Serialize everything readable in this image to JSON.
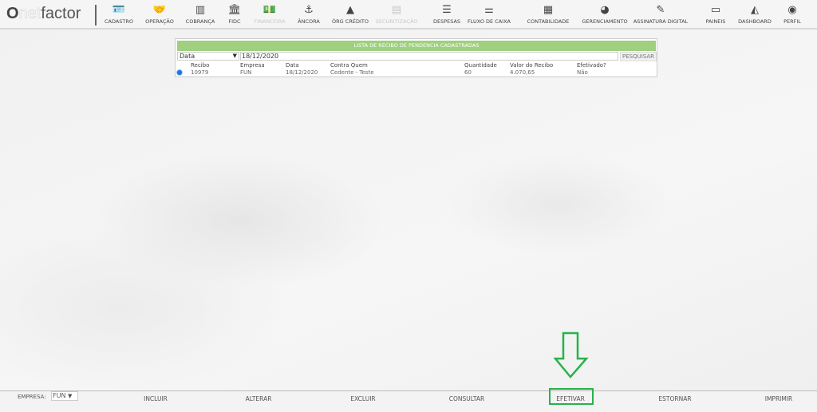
{
  "header": {
    "logo": "netfactor",
    "logo_o": "O",
    "logo_net": "net",
    "logo_factor": "factor",
    "nav": [
      {
        "label": "CADASTRO",
        "icon": "id-card-icon",
        "glyph": "🪪",
        "disabled": false
      },
      {
        "label": "OPERAÇÃO",
        "icon": "handshake-icon",
        "glyph": "🤝",
        "disabled": false
      },
      {
        "label": "COBRANÇA",
        "icon": "barcode-icon",
        "glyph": "▥",
        "disabled": false
      },
      {
        "label": "FIDC",
        "icon": "bank-icon",
        "glyph": "🏛",
        "disabled": false
      },
      {
        "label": "FINANCEIRA",
        "icon": "money-icon",
        "glyph": "💵",
        "disabled": true
      },
      {
        "label": "ÂNCORA",
        "icon": "anchor-icon",
        "glyph": "⚓",
        "disabled": false
      },
      {
        "label": "ÓRG CRÉDITO",
        "icon": "warning-icon",
        "glyph": "▲",
        "disabled": false
      },
      {
        "label": "SECURITIZAÇÃO",
        "icon": "book-icon",
        "glyph": "▤",
        "disabled": true
      },
      {
        "label": "DESPESAS",
        "icon": "list-icon",
        "glyph": "☰",
        "disabled": false
      },
      {
        "label": "FLUXO DE CAIXA",
        "icon": "sliders-icon",
        "glyph": "⚌",
        "disabled": false
      },
      {
        "label": "CONTABILIDADE",
        "icon": "calculator-icon",
        "glyph": "▦",
        "disabled": false
      },
      {
        "label": "GERENCIAMENTO",
        "icon": "pie-chart-icon",
        "glyph": "◕",
        "disabled": false
      },
      {
        "label": "ASSINATURA DIGITAL",
        "icon": "edit-icon",
        "glyph": "✎",
        "disabled": false
      },
      {
        "label": "PAINEIS",
        "icon": "monitor-icon",
        "glyph": "▭",
        "disabled": false
      },
      {
        "label": "DASHBOARD",
        "icon": "area-chart-icon",
        "glyph": "◭",
        "disabled": false
      },
      {
        "label": "PERFIL",
        "icon": "user-circle-icon",
        "glyph": "◉",
        "disabled": false
      }
    ]
  },
  "panel": {
    "title": "LISTA DE RECIBO DE PENDENCIA CADASTRADAS",
    "filter_field": "Data",
    "filter_value": "18/12/2020",
    "search_label": "PESQUISAR",
    "columns": [
      "Recibo",
      "Empresa",
      "Data",
      "Contra Quem",
      "Quantidade",
      "Valor do Recibo",
      "Efetivado?"
    ],
    "rows": [
      [
        "10979",
        "FUN",
        "18/12/2020",
        "Cedente - Teste",
        "60",
        "4.070,65",
        "Não"
      ]
    ]
  },
  "footer": {
    "empresa_label": "EMPRESA:",
    "empresa_value": "FUN",
    "actions": [
      "INCLUIR",
      "ALTERAR",
      "EXCLUIR",
      "CONSULTAR",
      "EFETIVAR",
      "ESTORNAR",
      "IMPRIMIR"
    ],
    "highlighted": "EFETIVAR",
    "highlight_color": "#27b24a"
  }
}
